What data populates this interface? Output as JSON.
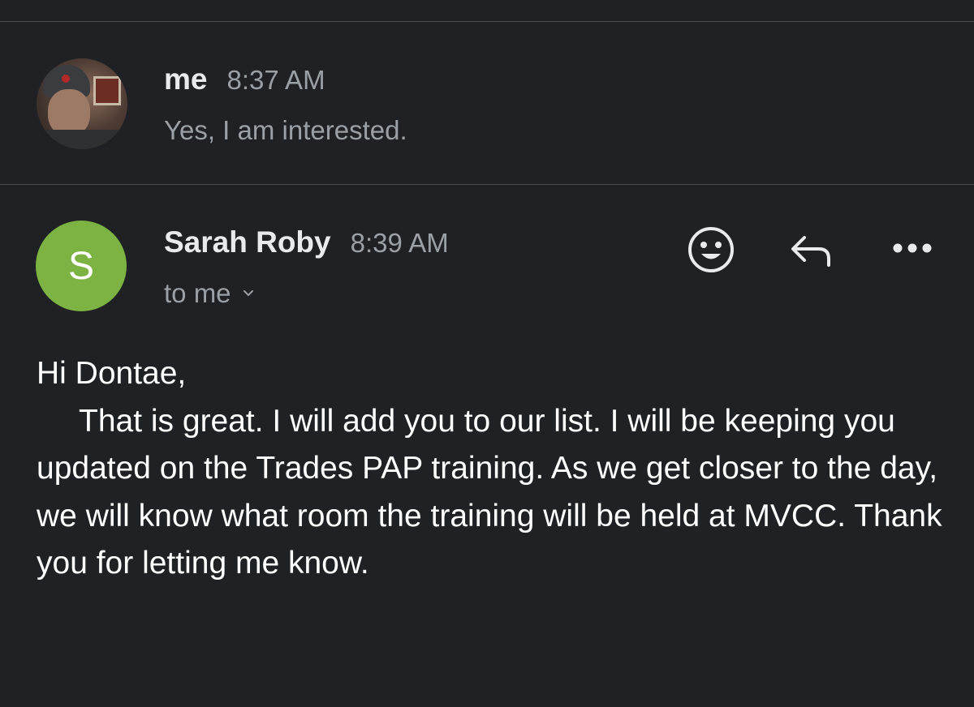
{
  "thread": {
    "messages": [
      {
        "sender": "me",
        "time": "8:37 AM",
        "snippet": "Yes, I am interested.",
        "avatar": "user-photo"
      },
      {
        "sender": "Sarah Roby",
        "time": "8:39 AM",
        "avatar_letter": "S",
        "avatar_color": "#7cb342",
        "recipient": "to me",
        "greeting": "Hi Dontae,",
        "body": "That is great. I will add you to our list. I will be keeping you updated on the Trades PAP training. As we get closer to the day, we will know what room the training will be held at MVCC. Thank you for letting me know."
      }
    ]
  },
  "actions": {
    "emoji_icon": "smiley-face-icon",
    "reply_icon": "reply-arrow-icon",
    "more_icon": "more-horizontal-icon"
  },
  "colors": {
    "background": "#202124",
    "primary_text": "#e8eaed",
    "secondary_text": "#9aa0a6",
    "divider": "#4a4b4e"
  }
}
